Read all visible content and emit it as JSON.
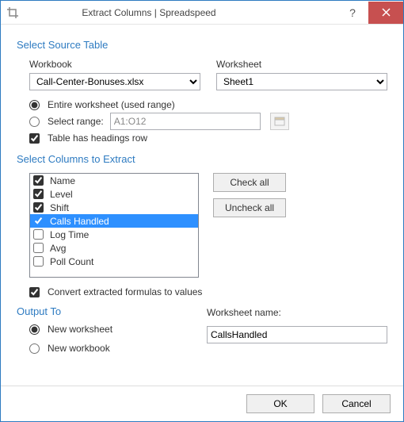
{
  "titlebar": {
    "title": "Extract Columns  |  Spreadspeed"
  },
  "source": {
    "heading": "Select Source Table",
    "workbook_label": "Workbook",
    "worksheet_label": "Worksheet",
    "workbook_value": "Call-Center-Bonuses.xlsx",
    "worksheet_value": "Sheet1",
    "entire_label": "Entire worksheet (used range)",
    "select_range_label": "Select range:",
    "range_value": "A1:O12",
    "headings_label": "Table has headings row"
  },
  "columns": {
    "heading": "Select Columns to Extract",
    "items": [
      {
        "label": "Name",
        "checked": true,
        "selected": false
      },
      {
        "label": "Level",
        "checked": true,
        "selected": false
      },
      {
        "label": "Shift",
        "checked": true,
        "selected": false
      },
      {
        "label": "Calls Handled",
        "checked": true,
        "selected": true
      },
      {
        "label": "Log Time",
        "checked": false,
        "selected": false
      },
      {
        "label": "Avg",
        "checked": false,
        "selected": false
      },
      {
        "label": "Poll Count",
        "checked": false,
        "selected": false
      }
    ],
    "check_all_label": "Check all",
    "uncheck_all_label": "Uncheck all"
  },
  "convert": {
    "label": "Convert extracted formulas to values"
  },
  "output": {
    "heading": "Output To",
    "wsname_label": "Worksheet name:",
    "new_ws_label": "New worksheet",
    "new_wb_label": "New workbook",
    "wsname_value": "CallsHandled"
  },
  "footer": {
    "ok": "OK",
    "cancel": "Cancel"
  }
}
